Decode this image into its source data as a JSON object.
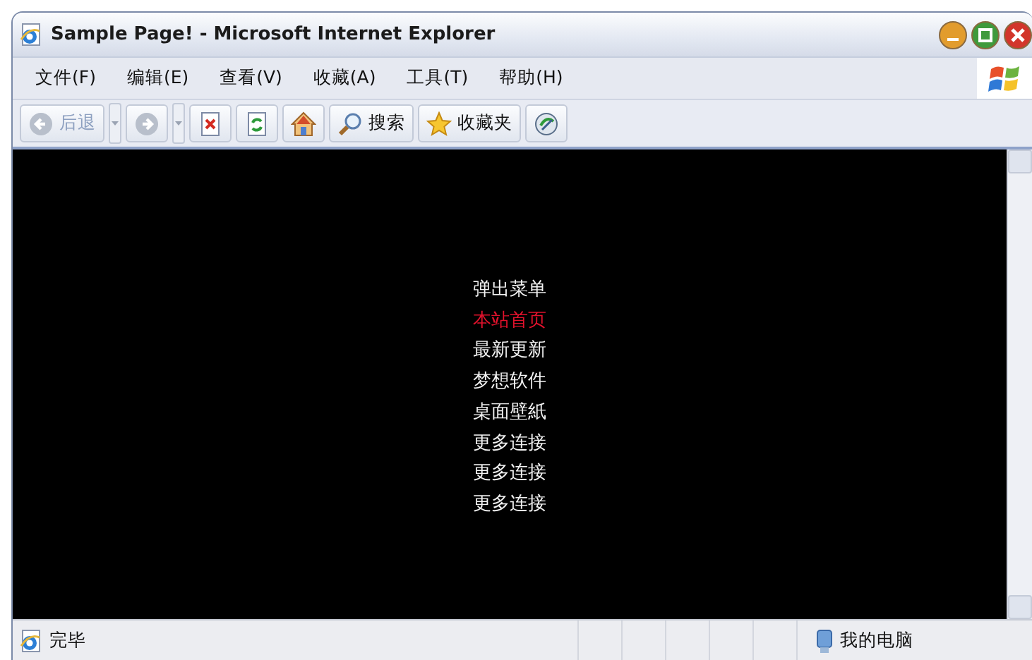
{
  "window": {
    "title": "Sample Page! - Microsoft Internet Explorer"
  },
  "menu_bar": [
    "文件(F)",
    "编辑(E)",
    "查看(V)",
    "收藏(A)",
    "工具(T)",
    "帮助(H)"
  ],
  "toolbar": [
    {
      "kind": "back",
      "label": "后退",
      "disabled": true
    },
    {
      "kind": "forward",
      "disabled": true
    },
    {
      "kind": "stop"
    },
    {
      "kind": "refresh"
    },
    {
      "kind": "home"
    },
    {
      "kind": "search",
      "label": "搜索"
    },
    {
      "kind": "favorites",
      "label": "收藏夹"
    },
    {
      "kind": "media"
    }
  ],
  "popup_menu": [
    {
      "label": "弹出菜单",
      "selected": false
    },
    {
      "label": "本站首页",
      "selected": true
    },
    {
      "label": "最新更新",
      "selected": false
    },
    {
      "label": "梦想软件",
      "selected": false
    },
    {
      "label": "桌面壁紙",
      "selected": false
    },
    {
      "label": "更多连接",
      "selected": false
    },
    {
      "label": "更多连接",
      "selected": false
    },
    {
      "label": "更多连接",
      "selected": false
    }
  ],
  "status_bar": {
    "status": "完毕",
    "zone": "我的电脑"
  }
}
